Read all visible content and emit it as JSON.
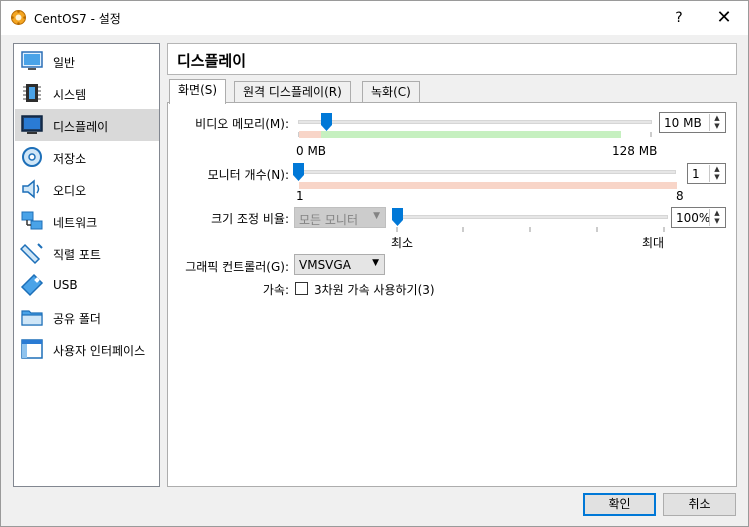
{
  "window": {
    "title": "CentOS7 - 설정",
    "help_label": "?",
    "close_label": "✕"
  },
  "sidebar": {
    "items": [
      {
        "label": "일반",
        "icon": "general-icon"
      },
      {
        "label": "시스템",
        "icon": "system-chip-icon"
      },
      {
        "label": "디스플레이",
        "icon": "display-monitor-icon",
        "selected": true
      },
      {
        "label": "저장소",
        "icon": "storage-disc-icon"
      },
      {
        "label": "오디오",
        "icon": "audio-speaker-icon"
      },
      {
        "label": "네트워크",
        "icon": "network-icon"
      },
      {
        "label": "직렬 포트",
        "icon": "serial-port-icon"
      },
      {
        "label": "USB",
        "icon": "usb-icon"
      },
      {
        "label": "공유 폴더",
        "icon": "shared-folder-icon"
      },
      {
        "label": "사용자 인터페이스",
        "icon": "user-interface-icon"
      }
    ]
  },
  "header": {
    "title": "디스플레이"
  },
  "tabs": [
    {
      "label": "화면(S)",
      "active": true
    },
    {
      "label": "원격 디스플레이(R)",
      "active": false
    },
    {
      "label": "녹화(C)",
      "active": false
    }
  ],
  "screen": {
    "video_memory": {
      "label": "비디오 메모리(M):",
      "value": "10 MB",
      "min_label": "0 MB",
      "max_label": "128 MB",
      "min": 0,
      "max": 128,
      "current": 10
    },
    "monitor_count": {
      "label": "모니터 개수(N):",
      "value": "1",
      "min_label": "1",
      "max_label": "8",
      "min": 1,
      "max": 8,
      "current": 1
    },
    "scale_factor": {
      "label": "크기 조정 비율:",
      "monitor_select": "모든 모니터",
      "value": "100%",
      "min_label": "최소",
      "max_label": "최대",
      "current_fraction": 0
    },
    "graphics_controller": {
      "label": "그래픽 컨트롤러(G):",
      "value": "VMSVGA"
    },
    "acceleration": {
      "label": "가속:",
      "checkbox_label": "3차원 가속 사용하기(3)",
      "checked": false
    }
  },
  "footer": {
    "ok_label": "확인",
    "cancel_label": "취소"
  },
  "colors": {
    "accent": "#0078d7",
    "green_range": "#c6f0c0",
    "red_range": "#f8d5c8",
    "selected_item": "#d9d9d9"
  }
}
